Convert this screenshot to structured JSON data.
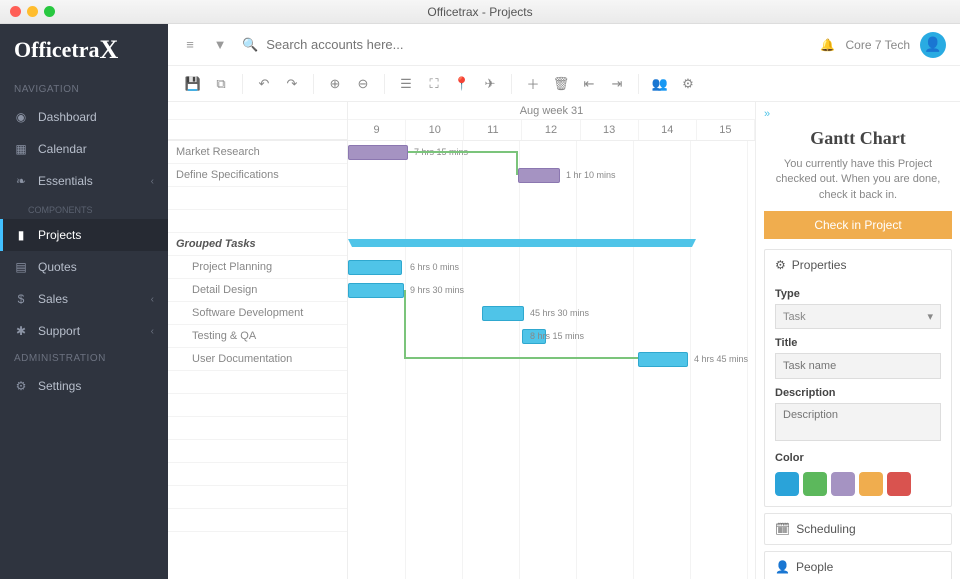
{
  "window_title": "Officetrax - Projects",
  "logo": "Officetra",
  "sidebar": {
    "sections": {
      "navigation": "NAVIGATION",
      "components": "COMPONENTS",
      "administration": "ADMINISTRATION"
    },
    "items": {
      "dashboard": "Dashboard",
      "calendar": "Calendar",
      "essentials": "Essentials",
      "projects": "Projects",
      "quotes": "Quotes",
      "sales": "Sales",
      "support": "Support",
      "settings": "Settings"
    }
  },
  "search_placeholder": "Search accounts here...",
  "user_name": "Core 7 Tech",
  "gantt": {
    "week_label": "Aug week 31",
    "days": [
      "9",
      "10",
      "11",
      "12",
      "13",
      "14",
      "15"
    ],
    "tasks": [
      {
        "name": "Market Research",
        "dur": "7 hrs 15 mins"
      },
      {
        "name": "Define Specifications",
        "dur": "1 hr 10 mins"
      },
      {
        "name": ""
      },
      {
        "name": ""
      },
      {
        "name": "Grouped Tasks",
        "group": true
      },
      {
        "name": "Project Planning",
        "sub": true,
        "dur": "6 hrs 0 mins"
      },
      {
        "name": "Detail Design",
        "sub": true,
        "dur": "9 hrs 30 mins"
      },
      {
        "name": "Software Development",
        "sub": true,
        "dur": "45 hrs 30 mins"
      },
      {
        "name": "Testing & QA",
        "sub": true,
        "dur": "8 hrs 15 mins"
      },
      {
        "name": "User Documentation",
        "sub": true,
        "dur": "4 hrs 45 mins"
      }
    ]
  },
  "side": {
    "title": "Gantt Chart",
    "msg": "You currently have this Project checked out. When you are done, check it back in.",
    "checkin": "Check in Project",
    "sections": {
      "properties": "Properties",
      "scheduling": "Scheduling",
      "people": "People"
    },
    "fields": {
      "type_label": "Type",
      "type_value": "Task",
      "title_label": "Title",
      "title_placeholder": "Task name",
      "desc_label": "Description",
      "desc_placeholder": "Description",
      "color_label": "Color"
    },
    "colors": [
      "#2aa3d9",
      "#5cb85c",
      "#a593c2",
      "#f0ad4e",
      "#d9534f"
    ]
  }
}
